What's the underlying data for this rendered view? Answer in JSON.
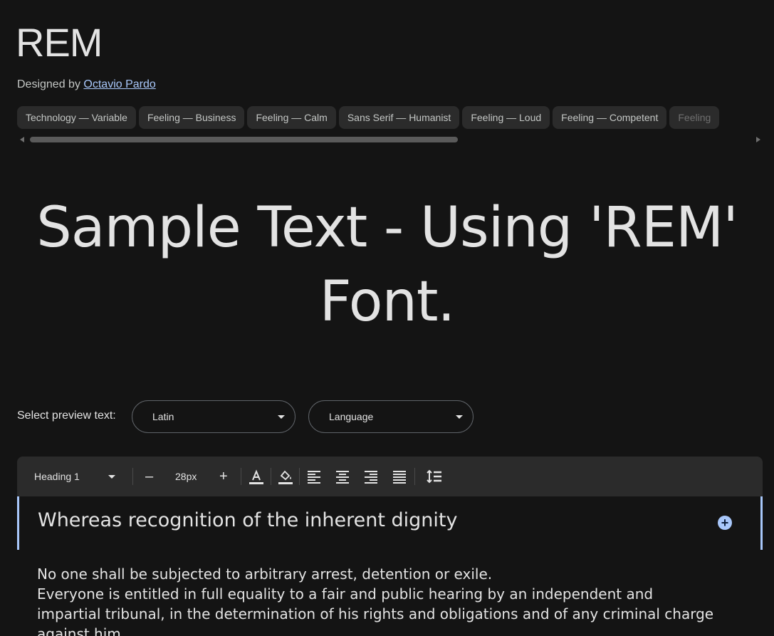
{
  "font": {
    "title": "REM",
    "designed_by_prefix": "Designed by",
    "designer_name": "Octavio Pardo"
  },
  "tags": [
    "Technology — Variable",
    "Feeling — Business",
    "Feeling — Calm",
    "Sans Serif — Humanist",
    "Feeling — Loud",
    "Feeling — Competent",
    "Feeling"
  ],
  "sample": {
    "line1": "Sample Text - Using 'REM'",
    "line2": "Font."
  },
  "preview": {
    "label": "Select preview text:",
    "script_select": "Latin",
    "language_select": "Language"
  },
  "toolbar": {
    "style_select": "Heading 1",
    "decrease_label": "–",
    "font_size": "28px",
    "increase_label": "+"
  },
  "editor": {
    "heading": "Whereas recognition of the inherent dignity",
    "add_label": "+",
    "paragraph1": "No one shall be subjected to arbitrary arrest, detention or exile.",
    "paragraph2": "Everyone is entitled in full equality to a fair and public hearing by an independent and impartial tribunal, in the determination of his rights and obligations and of any criminal charge against him."
  },
  "colors": {
    "background": "#141414",
    "chip": "#2b2b2b",
    "accent": "#a8c7fa",
    "text": "#e3e3e3"
  }
}
